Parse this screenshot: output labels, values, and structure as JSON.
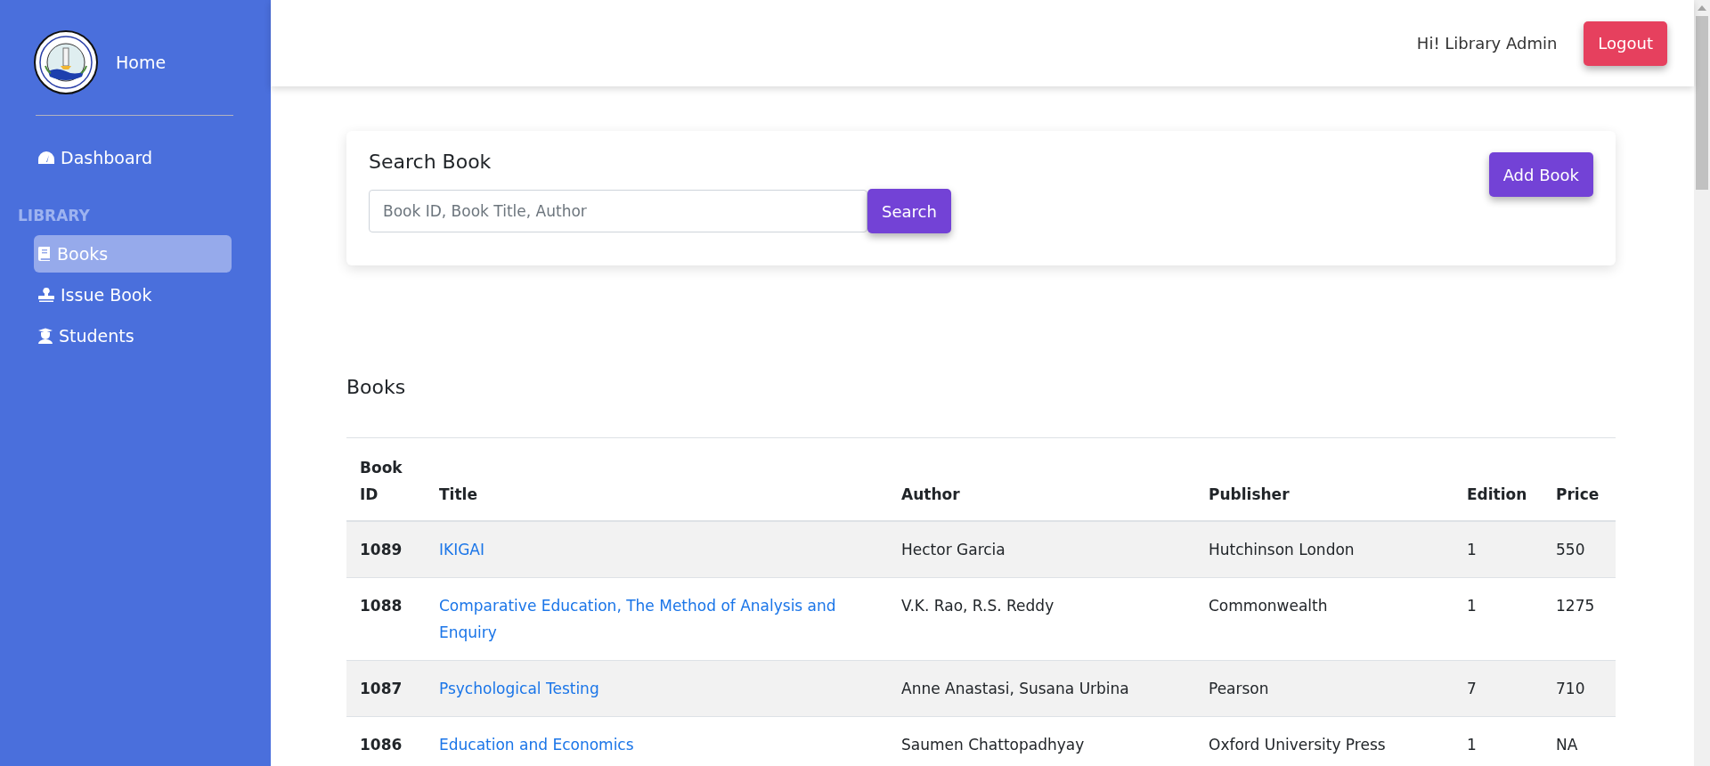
{
  "sidebar": {
    "home": "Home",
    "items": [
      {
        "label": "Dashboard",
        "selected": false
      }
    ],
    "section": "LIBRARY",
    "section_items": [
      {
        "label": "Books",
        "selected": true
      },
      {
        "label": "Issue Book",
        "selected": false
      },
      {
        "label": "Students",
        "selected": false
      }
    ]
  },
  "header": {
    "greeting": "Hi! Library Admin",
    "logout": "Logout"
  },
  "search": {
    "title": "Search Book",
    "placeholder": "Book ID, Book Title, Author",
    "button": "Search",
    "add_button": "Add Book"
  },
  "books": {
    "title": "Books",
    "columns": [
      "Book ID",
      "Title",
      "Author",
      "Publisher",
      "Edition",
      "Price"
    ],
    "rows": [
      {
        "id": "1089",
        "title": "IKIGAI",
        "author": "Hector Garcia",
        "publisher": "Hutchinson London",
        "edition": "1",
        "price": "550"
      },
      {
        "id": "1088",
        "title": "Comparative Education, The Method of Analysis and Enquiry",
        "author": "V.K. Rao, R.S. Reddy",
        "publisher": "Commonwealth",
        "edition": "1",
        "price": "1275"
      },
      {
        "id": "1087",
        "title": "Psychological Testing",
        "author": "Anne Anastasi, Susana Urbina",
        "publisher": "Pearson",
        "edition": "7",
        "price": "710"
      },
      {
        "id": "1086",
        "title": "Education and Economics",
        "author": "Saumen Chattopadhyay",
        "publisher": "Oxford University Press",
        "edition": "1",
        "price": "NA"
      }
    ]
  }
}
